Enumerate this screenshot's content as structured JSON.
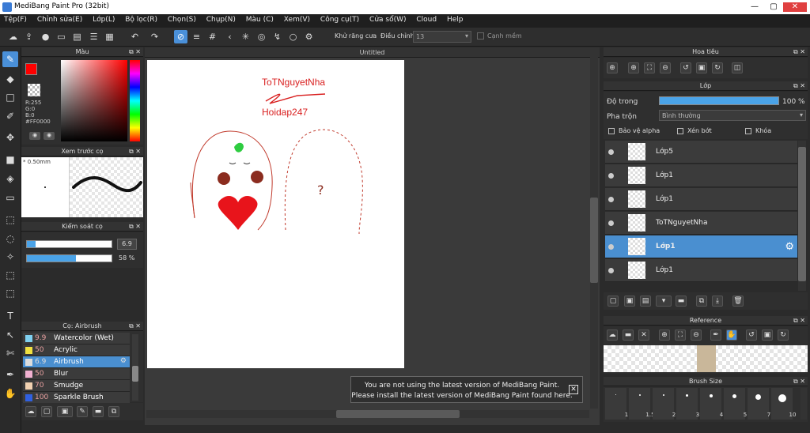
{
  "window": {
    "title": "MediBang Paint Pro (32bit)",
    "minimize": "—",
    "maximize": "▢",
    "close": "✕"
  },
  "menu": [
    "Tệp(F)",
    "Chỉnh sửa(E)",
    "Lớp(L)",
    "Bộ lọc(R)",
    "Chọn(S)",
    "Chụp(N)",
    "Màu (C)",
    "Xem(V)",
    "Công cụ(T)",
    "Cửa sổ(W)",
    "Cloud",
    "Help"
  ],
  "toolbar": {
    "antialias_label": "Khử răng cưa",
    "adjust_label": "Điều chỉnh",
    "adjust_value": "13",
    "sharp_edge_label": "Cạnh mềm"
  },
  "color_panel": {
    "title": "Màu",
    "r": "R:255",
    "g": "G:0",
    "b": "B:0",
    "hex": "#FF0000",
    "primary_color": "#ff0000"
  },
  "brush_preview": {
    "title": "Xem trước cọ",
    "size": "* 0.50mm"
  },
  "brush_control": {
    "title": "Kiểm soát cọ",
    "size_value": "6.9",
    "opacity_value": "58 %",
    "size_fraction": 0.1,
    "opacity_fraction": 0.58
  },
  "brush_list": {
    "title": "Cọ: Airbrush",
    "items": [
      {
        "size": "9.9",
        "name": "Watercolor (Wet)",
        "color": "#7fd0f0"
      },
      {
        "size": "50",
        "name": "Acrylic",
        "color": "#f0e040"
      },
      {
        "size": "6.9",
        "name": "Airbrush",
        "color": "#dddddd",
        "selected": true
      },
      {
        "size": "50",
        "name": "Blur",
        "color": "#f0b0d0"
      },
      {
        "size": "70",
        "name": "Smudge",
        "color": "#f0d0b0"
      },
      {
        "size": "100",
        "name": "Sparkle Brush",
        "color": "#3060e0"
      }
    ]
  },
  "canvas": {
    "tab_title": "Untitled",
    "text_top": "ToTNguyetNha",
    "text_bottom": "Hoidap247",
    "question_mark": "?"
  },
  "notice": {
    "line1": "You are not using the latest version of MediBang Paint.",
    "line2": "Please install the latest version of MediBang Paint found here.",
    "close": "✕"
  },
  "navigator": {
    "title": "Hoa tiêu"
  },
  "layer_panel": {
    "title": "Lớp",
    "opacity_label": "Độ trong",
    "opacity_value": "100 %",
    "opacity_fraction": 1.0,
    "blend_label": "Pha trộn",
    "blend_value": "Bình thường",
    "protect_alpha": "Bảo vệ alpha",
    "clipping": "Xén bớt",
    "lock": "Khóa",
    "layers": [
      {
        "name": "Lớp5",
        "selected": false
      },
      {
        "name": "Lớp1",
        "selected": false
      },
      {
        "name": "Lớp1",
        "selected": false
      },
      {
        "name": "ToTNguyetNha",
        "selected": false
      },
      {
        "name": "Lớp1",
        "selected": true
      },
      {
        "name": "Lớp1",
        "selected": false
      }
    ]
  },
  "reference": {
    "title": "Reference"
  },
  "brush_size": {
    "title": "Brush Size",
    "sizes": [
      "1",
      "1.5",
      "2",
      "3",
      "4",
      "5",
      "7",
      "10"
    ]
  }
}
